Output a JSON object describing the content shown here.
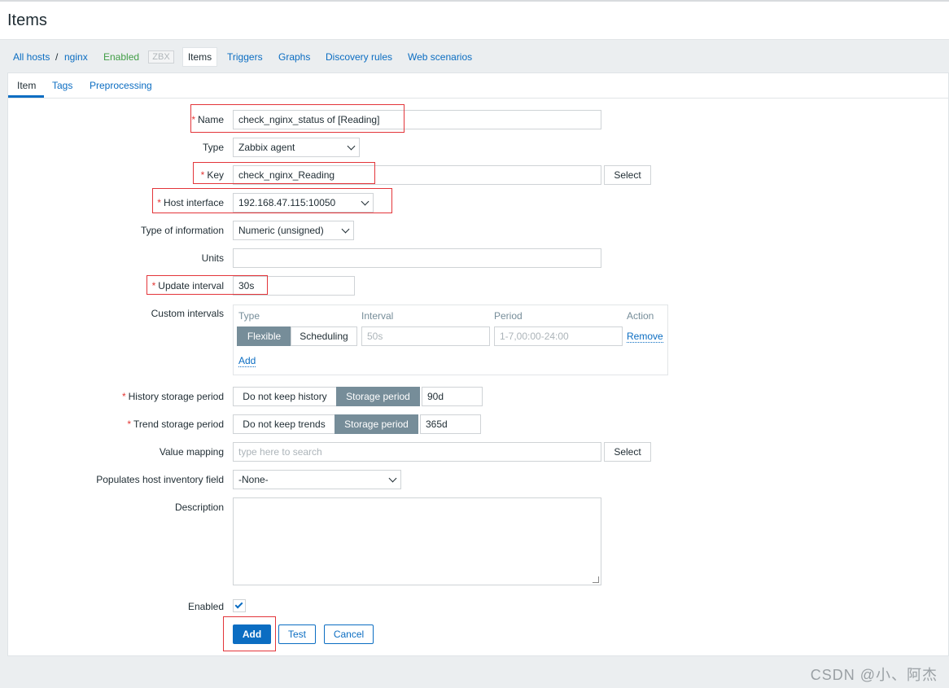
{
  "page": {
    "title": "Items"
  },
  "nav": {
    "all_hosts": "All hosts",
    "separator": "/",
    "host": "nginx",
    "status": "Enabled",
    "zbx": "ZBX",
    "items": "Items",
    "triggers": "Triggers",
    "graphs": "Graphs",
    "discovery": "Discovery rules",
    "web": "Web scenarios"
  },
  "tabs": {
    "item": "Item",
    "tags": "Tags",
    "preprocessing": "Preprocessing"
  },
  "form": {
    "required_mark": "*",
    "name": {
      "label": "Name",
      "value": "check_nginx_status of [Reading]"
    },
    "type": {
      "label": "Type",
      "value": "Zabbix agent"
    },
    "key": {
      "label": "Key",
      "value": "check_nginx_Reading",
      "select": "Select"
    },
    "host_interface": {
      "label": "Host interface",
      "value": "192.168.47.115:10050"
    },
    "type_of_info": {
      "label": "Type of information",
      "value": "Numeric (unsigned)"
    },
    "units": {
      "label": "Units",
      "value": ""
    },
    "update_interval": {
      "label": "Update interval",
      "value": "30s"
    },
    "custom_intervals": {
      "label": "Custom intervals",
      "col_type": "Type",
      "col_interval": "Interval",
      "col_period": "Period",
      "col_action": "Action",
      "flexible": "Flexible",
      "scheduling": "Scheduling",
      "interval_placeholder": "50s",
      "period_placeholder": "1-7,00:00-24:00",
      "remove": "Remove",
      "add": "Add"
    },
    "history": {
      "label": "History storage period",
      "opt1": "Do not keep history",
      "opt2": "Storage period",
      "value": "90d"
    },
    "trend": {
      "label": "Trend storage period",
      "opt1": "Do not keep trends",
      "opt2": "Storage period",
      "value": "365d"
    },
    "value_mapping": {
      "label": "Value mapping",
      "placeholder": "type here to search",
      "select": "Select"
    },
    "inventory": {
      "label": "Populates host inventory field",
      "value": "-None-"
    },
    "description": {
      "label": "Description",
      "value": ""
    },
    "enabled": {
      "label": "Enabled",
      "checked": true
    }
  },
  "buttons": {
    "add": "Add",
    "test": "Test",
    "cancel": "Cancel"
  },
  "watermark": "CSDN @小、阿杰",
  "colors": {
    "accent": "#0b6dc2",
    "highlight_box": "#e3353a",
    "segment_active": "#768d99",
    "required": "#e33734"
  }
}
